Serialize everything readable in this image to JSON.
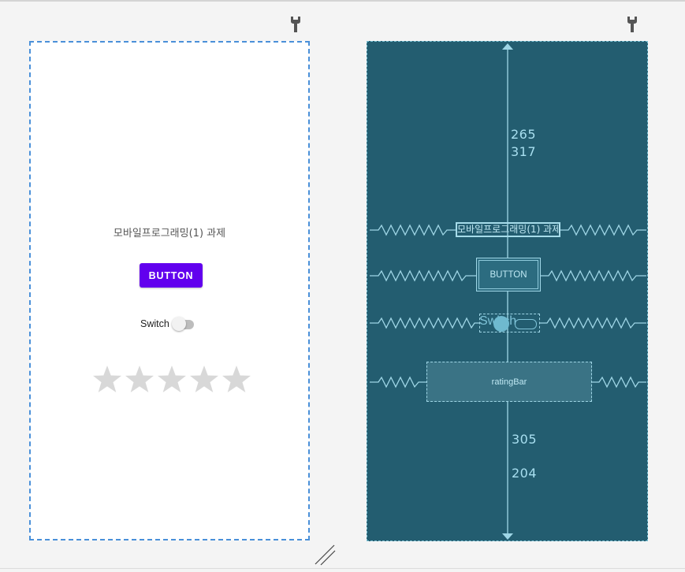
{
  "design": {
    "text_view": "모바일프로그래밍(1) 과제",
    "button_label": "BUTTON",
    "switch_label": "Switch",
    "rating": {
      "stars": 5,
      "value": 0
    }
  },
  "blueprint": {
    "text_view": "모바일프로그래밍(1) 과제",
    "button_label": "BUTTON",
    "switch_label": "Switch",
    "rating_label": "ratingBar",
    "top_margins": [
      "265",
      "317"
    ],
    "bottom_margins": [
      "305",
      "204"
    ]
  },
  "icons": {
    "toolbar_left": "wrench-icon",
    "toolbar_right": "wrench-icon",
    "resize": "resize-handle-icon"
  },
  "colors": {
    "accent": "#6200ee",
    "blueprint_bg": "#235d70",
    "selection": "#4a90d9"
  }
}
